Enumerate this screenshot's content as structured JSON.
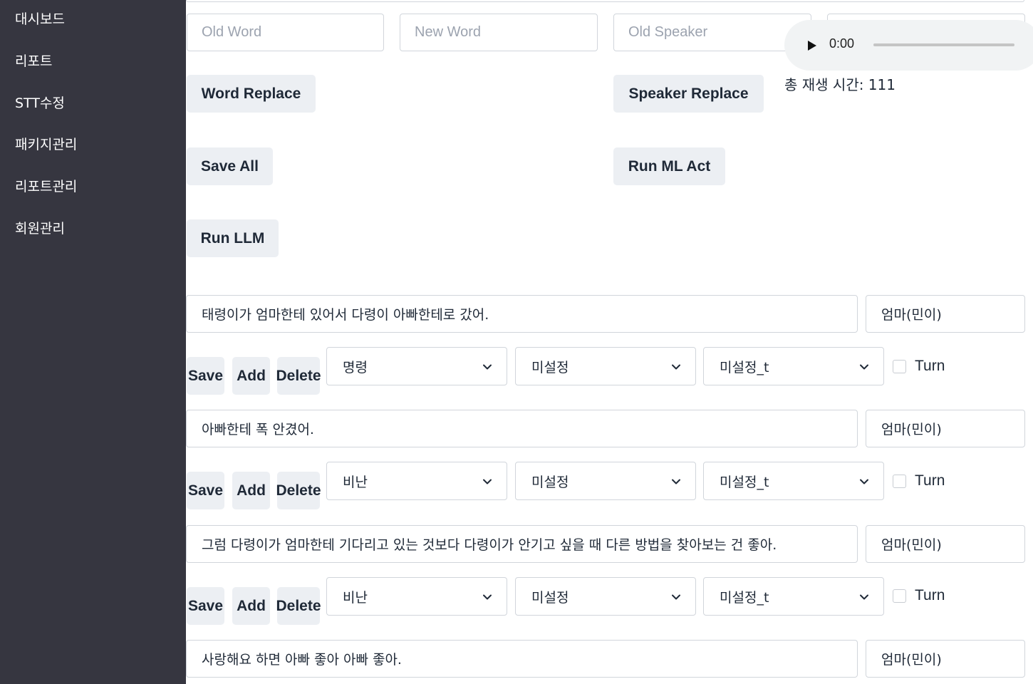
{
  "sidebar": {
    "items": [
      {
        "label": "대시보드"
      },
      {
        "label": "리포트"
      },
      {
        "label": "STT수정"
      },
      {
        "label": "패키지관리"
      },
      {
        "label": "리포트관리"
      },
      {
        "label": "회원관리"
      }
    ]
  },
  "replace_form": {
    "old_word_placeholder": "Old Word",
    "new_word_placeholder": "New Word",
    "old_speaker_placeholder": "Old Speaker",
    "word_replace_label": "Word Replace",
    "speaker_replace_label": "Speaker Replace",
    "save_all_label": "Save All",
    "run_ml_act_label": "Run ML Act",
    "run_llm_label": "Run LLM"
  },
  "audio": {
    "current_time": "0:00",
    "play_icon": "play-icon",
    "progress": 0,
    "total_time_text": "총 재생 시간: 111"
  },
  "row_actions": {
    "save_label": "Save",
    "add_label": "Add",
    "delete_label": "Delete",
    "turn_label": "Turn"
  },
  "utterances": [
    {
      "text": "태령이가 엄마한테 있어서 다령이 아빠한테로 갔어.",
      "speaker": "엄마(민이)",
      "category": "명령",
      "tag": "미설정",
      "tag_t": "미설정_t",
      "turn": false
    },
    {
      "text": "아빠한테 폭 안겼어.",
      "speaker": "엄마(민이)",
      "category": "비난",
      "tag": "미설정",
      "tag_t": "미설정_t",
      "turn": false
    },
    {
      "text": "그럼 다령이가 엄마한테 기다리고 있는 것보다 다령이가 안기고 싶을 때 다른 방법을 찾아보는 건 좋아.",
      "speaker": "엄마(민이)",
      "category": "비난",
      "tag": "미설정",
      "tag_t": "미설정_t",
      "turn": false
    },
    {
      "text": "사랑해요 하면 아빠 좋아 아빠 좋아.",
      "speaker": "엄마(민이)"
    }
  ]
}
